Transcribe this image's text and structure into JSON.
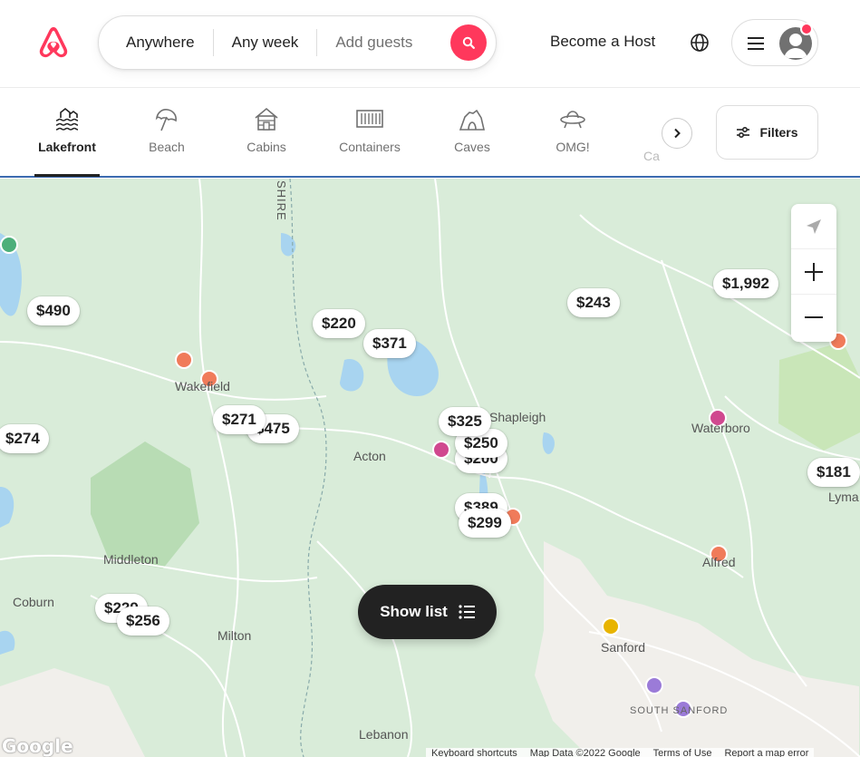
{
  "header": {
    "brand": "airbnb-logo",
    "search": {
      "where": "Anywhere",
      "when": "Any week",
      "guests_placeholder": "Add guests"
    },
    "become_host": "Become a Host"
  },
  "categories": [
    {
      "label": "Lakefront",
      "icon": "lakefront-icon",
      "active": true
    },
    {
      "label": "Beach",
      "icon": "beach-umbrella-icon",
      "active": false
    },
    {
      "label": "Cabins",
      "icon": "cabin-icon",
      "active": false
    },
    {
      "label": "Containers",
      "icon": "container-icon",
      "active": false
    },
    {
      "label": "Caves",
      "icon": "cave-icon",
      "active": false
    },
    {
      "label": "OMG!",
      "icon": "ufo-icon",
      "active": false
    }
  ],
  "categories_partial_label": "Ca",
  "filters_label": "Filters",
  "map": {
    "prices": [
      "$490",
      "$220",
      "$371",
      "$243",
      "$1,992",
      "$271",
      "$475",
      "$274",
      "$325",
      "$250",
      "$200",
      "$389",
      "$299",
      "$181",
      "$229",
      "$256"
    ],
    "towns": [
      "Wakefield",
      "Acton",
      "Shapleigh",
      "Waterboro",
      "Middleton",
      "Coburn",
      "Milton",
      "Alfred",
      "Sanford",
      "SOUTH SANFORD",
      "Lebanon",
      "Lyma",
      "SHIRE"
    ],
    "show_list": "Show list",
    "google_label": "Google",
    "attribution": [
      "Keyboard shortcuts",
      "Map Data ©2022 Google",
      "Terms of Use",
      "Report a map error"
    ]
  },
  "colors": {
    "brand": "#ff385c",
    "map_green": "#d9ecd9",
    "water": "#a8d4f0"
  }
}
